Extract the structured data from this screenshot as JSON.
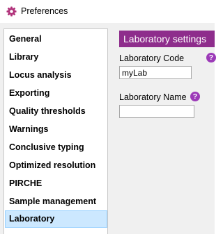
{
  "window": {
    "title": "Preferences",
    "icon": "gear-icon"
  },
  "sidebar": {
    "items": [
      {
        "label": "General",
        "selected": false
      },
      {
        "label": "Library",
        "selected": false
      },
      {
        "label": "Locus analysis",
        "selected": false
      },
      {
        "label": "Exporting",
        "selected": false
      },
      {
        "label": "Quality thresholds",
        "selected": false
      },
      {
        "label": "Warnings",
        "selected": false
      },
      {
        "label": "Conclusive typing",
        "selected": false
      },
      {
        "label": "Optimized resolution",
        "selected": false
      },
      {
        "label": "PIRCHE",
        "selected": false
      },
      {
        "label": "Sample management",
        "selected": false
      },
      {
        "label": "Laboratory",
        "selected": true
      }
    ]
  },
  "panel": {
    "title": "Laboratory settings",
    "laboratory_code": {
      "label": "Laboratory Code",
      "value": "myLab",
      "help": "?"
    },
    "laboratory_name": {
      "label": "Laboratory Name",
      "value": "",
      "help": "?"
    }
  },
  "colors": {
    "accent": "#8e2d8c",
    "help_icon": "#9c3ab8",
    "selection": "#cce8ff",
    "selection_border": "#99d1ff"
  }
}
